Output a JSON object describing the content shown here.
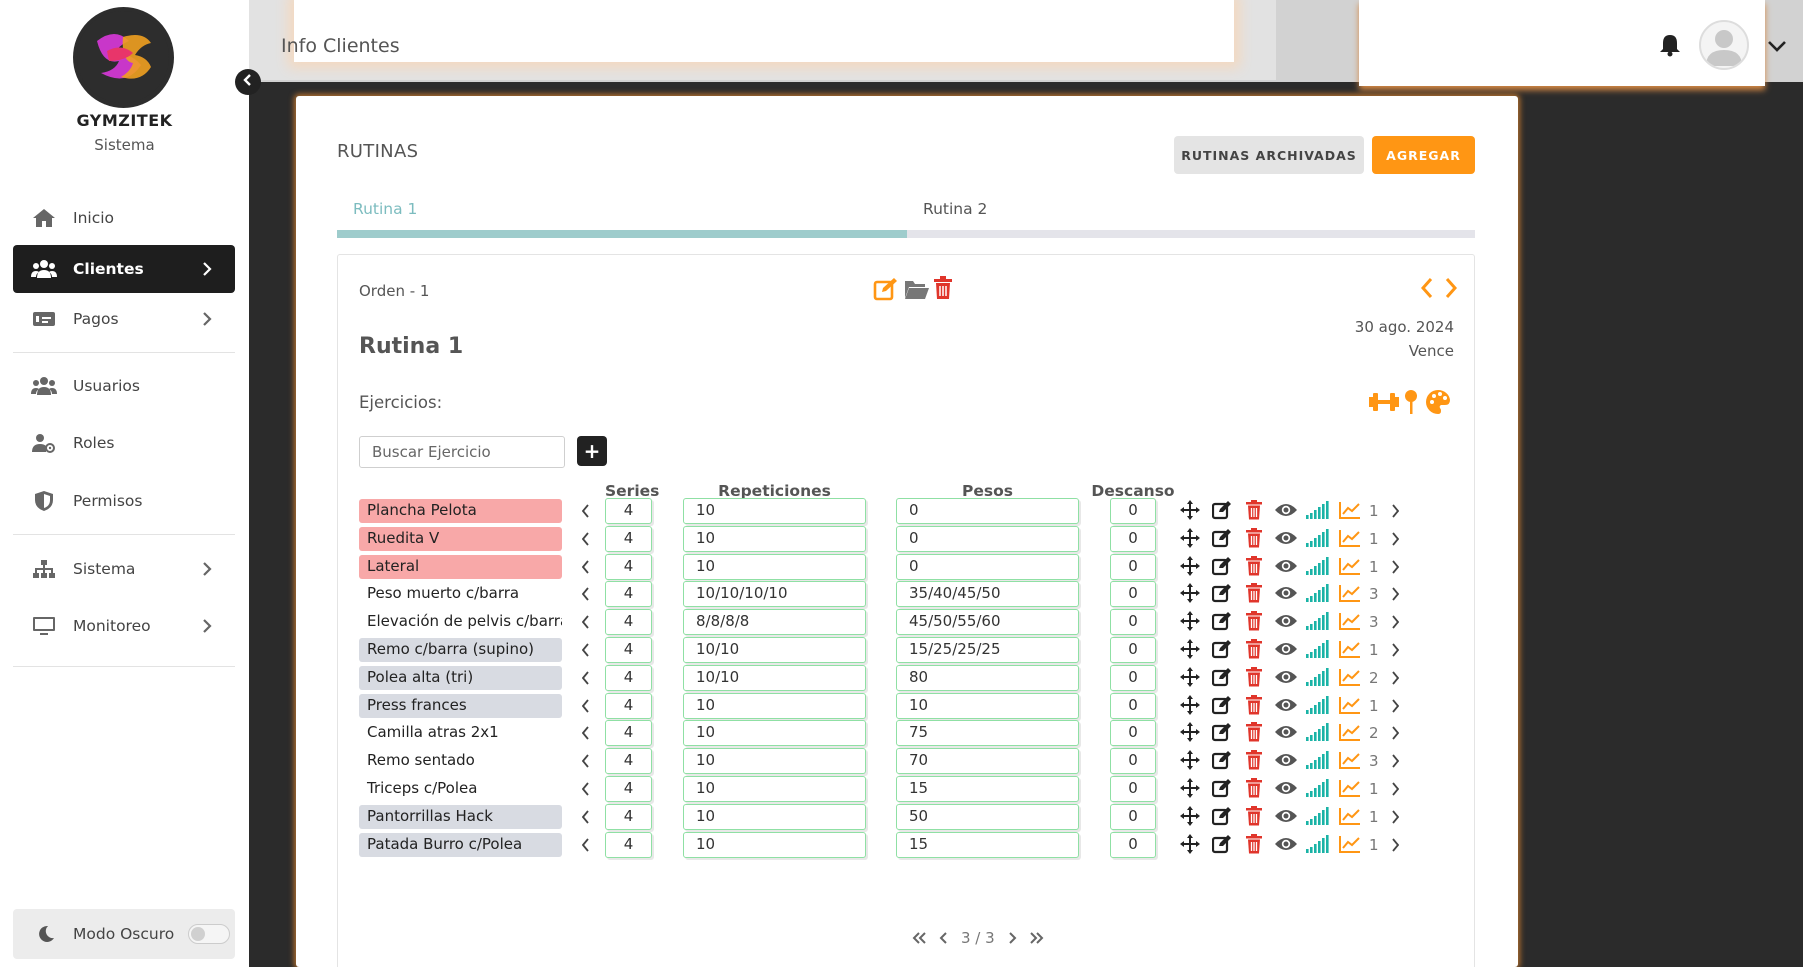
{
  "app": {
    "brand": "GYMZITEK",
    "brand_sub": "Sistema"
  },
  "sidebar": {
    "items": [
      {
        "label": "Inicio",
        "icon": "home-icon",
        "chevron": false,
        "active": false
      },
      {
        "label": "Clientes",
        "icon": "users-icon",
        "chevron": true,
        "active": true
      },
      {
        "label": "Pagos",
        "icon": "money-icon",
        "chevron": true,
        "active": false
      },
      {
        "label": "Usuarios",
        "icon": "users-icon",
        "chevron": false,
        "active": false
      },
      {
        "label": "Roles",
        "icon": "user-cog-icon",
        "chevron": false,
        "active": false
      },
      {
        "label": "Permisos",
        "icon": "shield-icon",
        "chevron": false,
        "active": false
      },
      {
        "label": "Sistema",
        "icon": "sitemap-icon",
        "chevron": true,
        "active": false
      },
      {
        "label": "Monitoreo",
        "icon": "monitor-icon",
        "chevron": true,
        "active": false
      }
    ],
    "dark_mode_label": "Modo Oscuro"
  },
  "header": {
    "title": "Info Clientes"
  },
  "main": {
    "title": "RUTINAS",
    "archived_label": "RUTINAS ARCHIVADAS",
    "add_label": "AGREGAR",
    "tabs": [
      {
        "label": "Rutina 1"
      },
      {
        "label": "Rutina 2"
      }
    ],
    "routine": {
      "orden": "Orden - 1",
      "name": "Rutina 1",
      "date": "30 ago. 2024",
      "expires": "Vence",
      "exercises_label": "Ejercicios:",
      "search_placeholder": "Buscar Ejercicio",
      "plus": "+",
      "columns": {
        "series": "Series",
        "reps": "Repeticiones",
        "pesos": "Pesos",
        "descanso": "Descanso"
      },
      "rows": [
        {
          "name": "Plancha Pelota",
          "tag": "red",
          "series": "4",
          "reps": "10",
          "pesos": "0",
          "descanso": "0",
          "count": "1"
        },
        {
          "name": "Ruedita V",
          "tag": "red",
          "series": "4",
          "reps": "10",
          "pesos": "0",
          "descanso": "0",
          "count": "1"
        },
        {
          "name": "Lateral",
          "tag": "red",
          "series": "4",
          "reps": "10",
          "pesos": "0",
          "descanso": "0",
          "count": "1"
        },
        {
          "name": "Peso muerto c/barra",
          "tag": "none",
          "series": "4",
          "reps": "10/10/10/10",
          "pesos": "35/40/45/50",
          "descanso": "0",
          "count": "3"
        },
        {
          "name": "Elevación de pelvis c/barra",
          "tag": "none",
          "series": "4",
          "reps": "8/8/8/8",
          "pesos": "45/50/55/60",
          "descanso": "0",
          "count": "3"
        },
        {
          "name": "Remo c/barra (supino)",
          "tag": "gray",
          "series": "4",
          "reps": "10/10",
          "pesos": "15/25/25/25",
          "descanso": "0",
          "count": "1"
        },
        {
          "name": "Polea alta (tri)",
          "tag": "gray",
          "series": "4",
          "reps": "10/10",
          "pesos": "80",
          "descanso": "0",
          "count": "2"
        },
        {
          "name": "Press frances",
          "tag": "gray",
          "series": "4",
          "reps": "10",
          "pesos": "10",
          "descanso": "0",
          "count": "1"
        },
        {
          "name": "Camilla atras 2x1",
          "tag": "none",
          "series": "4",
          "reps": "10",
          "pesos": "75",
          "descanso": "0",
          "count": "2"
        },
        {
          "name": "Remo sentado",
          "tag": "none",
          "series": "4",
          "reps": "10",
          "pesos": "70",
          "descanso": "0",
          "count": "3"
        },
        {
          "name": "Triceps c/Polea",
          "tag": "none",
          "series": "4",
          "reps": "10",
          "pesos": "15",
          "descanso": "0",
          "count": "1"
        },
        {
          "name": "Pantorrillas Hack",
          "tag": "gray",
          "series": "4",
          "reps": "10",
          "pesos": "50",
          "descanso": "0",
          "count": "1"
        },
        {
          "name": "Patada Burro c/Polea",
          "tag": "gray",
          "series": "4",
          "reps": "10",
          "pesos": "15",
          "descanso": "0",
          "count": "1"
        }
      ],
      "pager": "3 / 3"
    }
  },
  "colors": {
    "accent": "#ff9614",
    "tab_active": "#7cbcbf",
    "delete": "#e0352b",
    "stats": "#1ab3a6",
    "input_border": "#8fe0a4"
  }
}
